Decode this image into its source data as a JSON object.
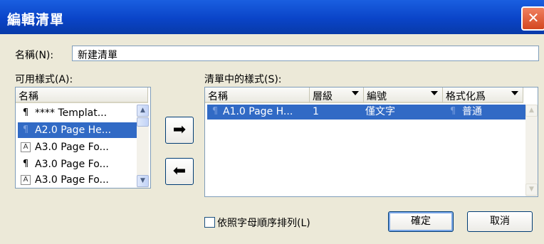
{
  "window": {
    "title": "編輯清單",
    "close_glyph": "✕"
  },
  "name_field": {
    "label": "名稱(N):",
    "value": "新建清單"
  },
  "available": {
    "label": "可用樣式(A):",
    "header": "名稱",
    "items": [
      {
        "icon": "paragraph-icon",
        "glyph": "¶",
        "text": "**** Templat...",
        "selected": false
      },
      {
        "icon": "paragraph-icon",
        "glyph": "¶",
        "text": "A2.0 Page He...",
        "selected": true
      },
      {
        "icon": "character-icon",
        "glyph": "A",
        "text": "A3.0 Page Fo...",
        "selected": false
      },
      {
        "icon": "paragraph-icon",
        "glyph": "¶",
        "text": "A3.0 Page Fo...",
        "selected": false
      },
      {
        "icon": "character-icon",
        "glyph": "A",
        "text": "A3.0 Page Fo...",
        "selected": false
      }
    ]
  },
  "move_buttons": {
    "add_glyph": "➡",
    "remove_glyph": "⬅"
  },
  "list_styles": {
    "label": "清單中的樣式(S):",
    "columns": {
      "name": "名稱",
      "level": "層級",
      "numbering": "編號",
      "formatted_as": "格式化爲"
    },
    "rows": [
      {
        "icon": "paragraph-icon",
        "glyph": "¶",
        "name": "A1.0 Page H...",
        "level": "1",
        "numbering": "僅文字",
        "formatted_glyph": "¶",
        "formatted_as": "普通"
      }
    ]
  },
  "sort_checkbox": {
    "label": "依照字母順序排列(L)",
    "checked": false
  },
  "buttons": {
    "ok": "確定",
    "cancel": "取消"
  },
  "colors": {
    "titlebar": "#0a44c8",
    "selection": "#316ac5",
    "dialog_bg": "#ece9d8"
  }
}
